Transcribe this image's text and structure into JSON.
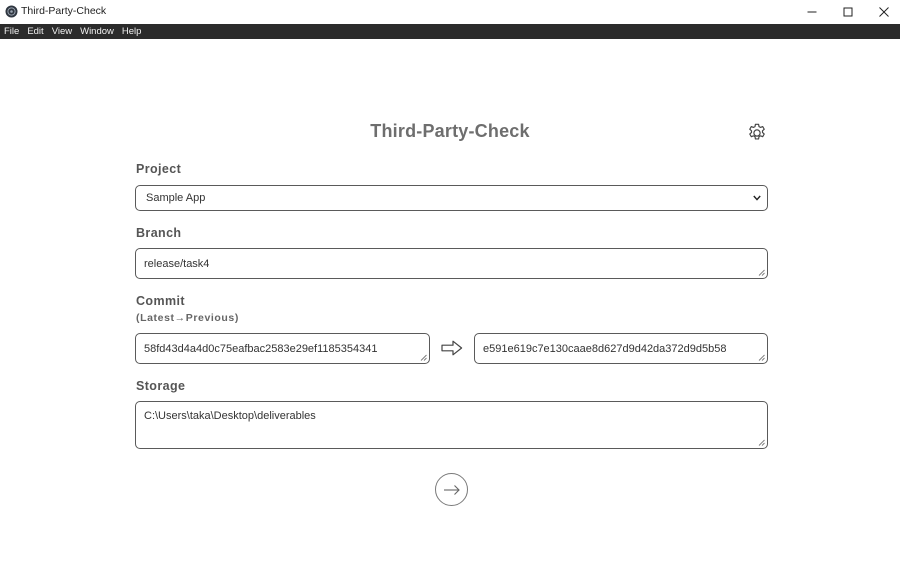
{
  "window": {
    "title": "Third-Party-Check"
  },
  "menu": [
    "File",
    "Edit",
    "View",
    "Window",
    "Help"
  ],
  "main": {
    "title": "Third-Party-Check",
    "project": {
      "label": "Project",
      "selected": "Sample App"
    },
    "branch": {
      "label": "Branch",
      "value": "release/task4"
    },
    "commit": {
      "label": "Commit",
      "sublabel": "(Latest→Previous)",
      "latest": "58fd43d4a4d0c75eafbac2583e29ef1185354341",
      "previous": "e591e619c7e130caae8d627d9d42da372d9d5b58"
    },
    "storage": {
      "label": "Storage",
      "value": "C:\\Users\\taka\\Desktop\\deliverables"
    }
  },
  "icons": {
    "app": "app-logo-icon",
    "settings": "gear-icon",
    "commit_arrow": "arrow-right-outline-icon",
    "submit": "arrow-right-icon"
  },
  "colors": {
    "menubar": "#2b2b2b",
    "title_text": "#6e6e6e",
    "field_border": "#5a5a5a"
  }
}
